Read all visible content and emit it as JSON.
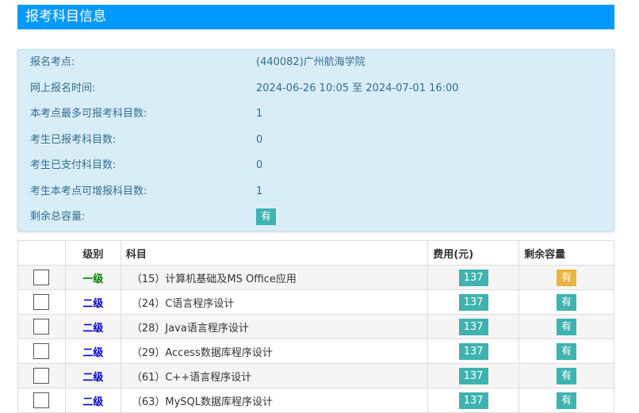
{
  "header": {
    "title": "报考科目信息"
  },
  "info": {
    "rows": [
      {
        "label": "报名考点:",
        "value": "(440082)广州航海学院"
      },
      {
        "label": "网上报名时间:",
        "value": "2024-06-26 10:05 至 2024-07-01 16:00"
      },
      {
        "label": "本考点最多可报考科目数:",
        "value": "1"
      },
      {
        "label": "考生已报考科目数:",
        "value": "0"
      },
      {
        "label": "考生已支付科目数:",
        "value": "0"
      },
      {
        "label": "考生本考点可增报科目数:",
        "value": "1"
      },
      {
        "label": "剩余总容量:",
        "value": "有"
      }
    ]
  },
  "table": {
    "headers": {
      "checkbox": "",
      "level": "级别",
      "subject": "科目",
      "fee": "费用(元)",
      "capacity": "剩余容量"
    },
    "rows": [
      {
        "level": "一级",
        "level_color": "#008000",
        "subject": "（15）计算机基础及MS Office应用",
        "fee": "137",
        "capacity": "有",
        "capacity_color": "#e9b53f"
      },
      {
        "level": "二级",
        "level_color": "#0000cc",
        "subject": "（24）C语言程序设计",
        "fee": "137",
        "capacity": "有",
        "capacity_color": "#3eb3b0"
      },
      {
        "level": "二级",
        "level_color": "#0000cc",
        "subject": "（28）Java语言程序设计",
        "fee": "137",
        "capacity": "有",
        "capacity_color": "#3eb3b0"
      },
      {
        "level": "二级",
        "level_color": "#0000cc",
        "subject": "（29）Access数据库程序设计",
        "fee": "137",
        "capacity": "有",
        "capacity_color": "#3eb3b0"
      },
      {
        "level": "二级",
        "level_color": "#0000cc",
        "subject": "（61）C++语言程序设计",
        "fee": "137",
        "capacity": "有",
        "capacity_color": "#3eb3b0"
      },
      {
        "level": "二级",
        "level_color": "#0000cc",
        "subject": "（63）MySQL数据库程序设计",
        "fee": "137",
        "capacity": "有",
        "capacity_color": "#3eb3b0"
      }
    ]
  },
  "colors": {
    "header_bg": "#0099ff",
    "panel_bg": "#d9edf7",
    "badge_teal": "#3eb3b0",
    "badge_warn": "#e9b53f"
  }
}
